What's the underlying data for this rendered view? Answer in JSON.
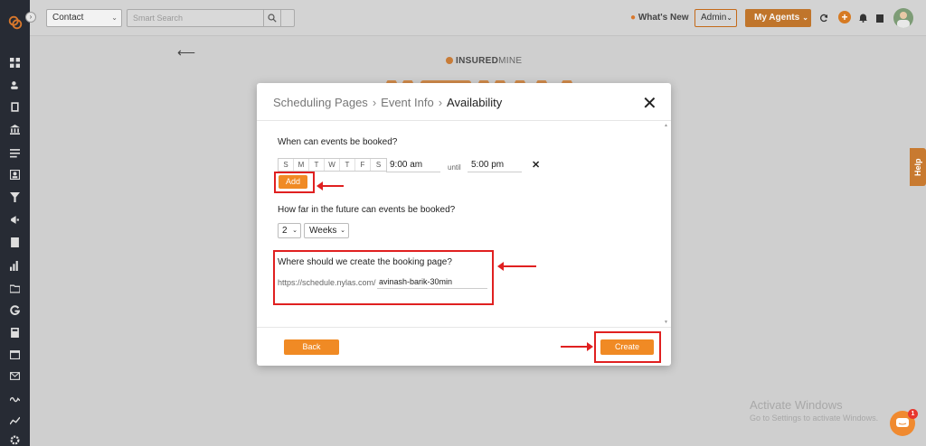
{
  "topbar": {
    "contact_select": "Contact",
    "search_placeholder": "Smart Search",
    "whats_new": "What's New",
    "admin_select": "Admin",
    "agents_button": "My Agents"
  },
  "brand": {
    "insured": "INSURED",
    "mine": "MINE"
  },
  "help_tab": "Help",
  "modal": {
    "breadcrumb": [
      "Scheduling Pages",
      "Event Info",
      "Availability"
    ],
    "q_when": "When can events be booked?",
    "days": [
      "S",
      "M",
      "T",
      "W",
      "T",
      "F",
      "S"
    ],
    "start_time": "9:00 am",
    "until_label": "until",
    "end_time": "5:00 pm",
    "add_label": "Add",
    "q_future": "How far in the future can events be booked?",
    "future_number": "2",
    "future_unit": "Weeks",
    "q_where": "Where should we create the booking page?",
    "url_prefix": "https://schedule.nylas.com/",
    "slug": "avinash-barik-30min",
    "back_label": "Back",
    "create_label": "Create"
  },
  "watermark": {
    "line1": "Activate Windows",
    "line2": "Go to Settings to activate Windows."
  },
  "chat_badge": "1",
  "colors": {
    "sidebar": "#272b34",
    "accent": "#f08a24",
    "annotation": "#e02020"
  }
}
